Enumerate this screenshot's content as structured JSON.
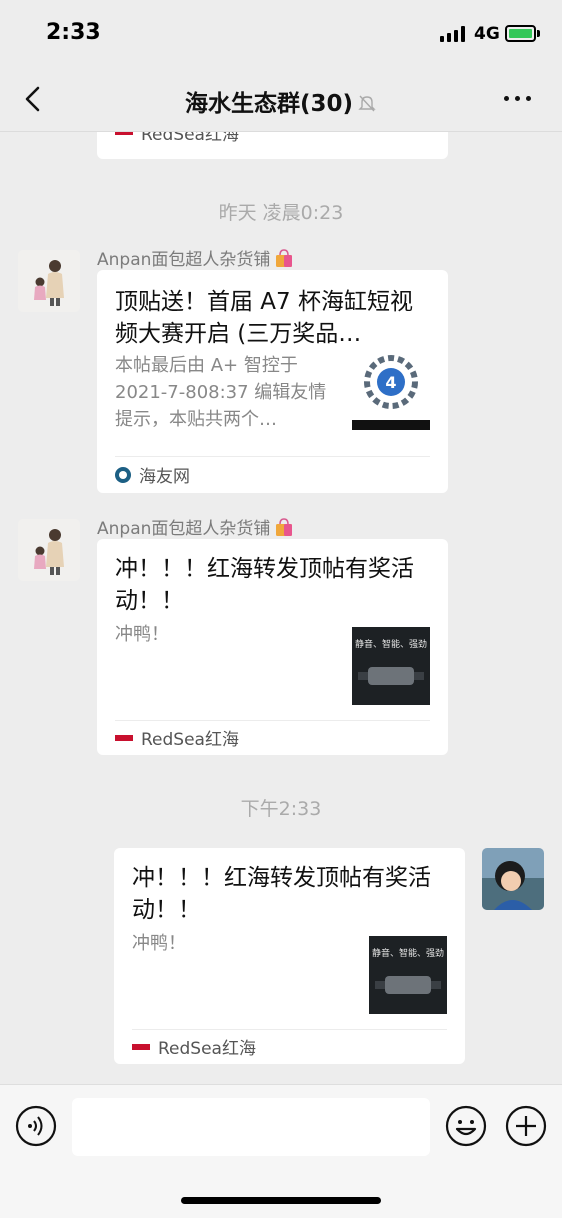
{
  "status_bar": {
    "time": "2:33",
    "network": "4G"
  },
  "header": {
    "title": "海水生态群(30)"
  },
  "messages": {
    "top_partial": {
      "source": "RedSea红海"
    },
    "timestamp_1": "昨天 凌晨0:23",
    "msg1": {
      "sender": "Anpan面包超人杂货铺",
      "title": "顶贴送！首届 A7 杯海缸短视频大赛开启 (三万奖品…",
      "desc": "本帖最后由 A+ 智控于 2021-7-808:37 编辑友情提示，本贴共两个…",
      "source": "海友网"
    },
    "msg2": {
      "sender": "Anpan面包超人杂货铺",
      "title": "冲！！！红海转发顶帖有奖活动！！",
      "desc": "冲鸭！",
      "thumb_caption": "静音、智能、强劲",
      "source": "RedSea红海"
    },
    "timestamp_2": "下午2:33",
    "msg3": {
      "title": "冲！！！红海转发顶帖有奖活动！！",
      "desc": "冲鸭！",
      "thumb_caption": "静音、智能、强劲",
      "source": "RedSea红海"
    }
  },
  "colors": {
    "background": "#ededed",
    "card": "#ffffff",
    "muted_text": "#888888",
    "battery": "#34c759"
  },
  "icons": [
    "back-icon",
    "mute-icon",
    "more-icon",
    "bag-icon",
    "voice-icon",
    "emoji-icon",
    "plus-icon"
  ]
}
